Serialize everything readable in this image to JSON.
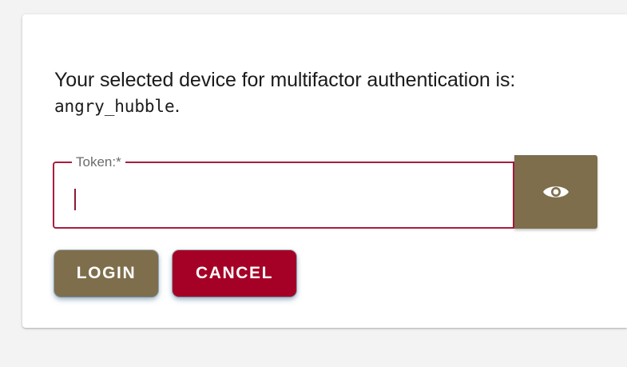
{
  "mfa": {
    "message_prefix": "Your selected device for multifactor authentication is:",
    "device_name": "angry_hubble",
    "message_suffix": ".",
    "token_label": "Token:*",
    "token_value": "",
    "reveal_icon": "eye-icon"
  },
  "actions": {
    "login_label": "LOGIN",
    "cancel_label": "CANCEL"
  },
  "colors": {
    "primary": "#7e6e4c",
    "danger": "#a50025",
    "field_border": "#a81d3e"
  }
}
